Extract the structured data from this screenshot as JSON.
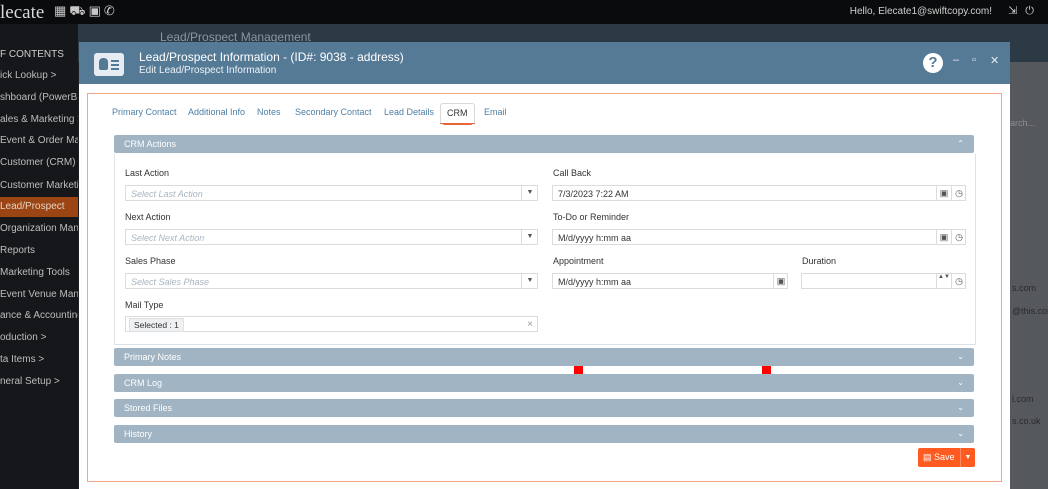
{
  "app": {
    "brand": "lecate",
    "top_icons": "▦⛟▣✆",
    "greeting": "Hello, Elecate1@swiftcopy.com!",
    "top_right_icons": "⇲⏻"
  },
  "sidebar": {
    "items": [
      {
        "label": "F CONTENTS"
      },
      {
        "label": "ick Lookup  >"
      },
      {
        "label": "shboard (PowerBI)"
      },
      {
        "label": "ales & Marketing  >"
      },
      {
        "label": "Event & Order Mana..."
      },
      {
        "label": "Customer (CRM)  ∨"
      },
      {
        "label": "   Customer Marketing"
      },
      {
        "label": "   Lead/Prospect"
      },
      {
        "label": "   Organization Mana..."
      },
      {
        "label": "   Reports"
      },
      {
        "label": "   Marketing Tools"
      },
      {
        "label": "Event Venue Manage"
      },
      {
        "label": "ance & Accounting"
      },
      {
        "label": "oduction  >"
      },
      {
        "label": "ta Items  >"
      },
      {
        "label": "neral Setup  >"
      }
    ]
  },
  "background": {
    "page_title": "Lead/Prospect Management",
    "search_placeholder": "arch...",
    "right_snippets": [
      "s.com",
      "@this.com",
      "l.com",
      "s.co.uk"
    ]
  },
  "modal": {
    "title": "Lead/Prospect Information - (ID#: 9038 - address)",
    "subtitle": "Edit Lead/Prospect Information",
    "help": "?",
    "minimize": "–",
    "maximize": "▫",
    "close": "✕",
    "tabs": [
      {
        "label": "Primary Contact"
      },
      {
        "label": "Additional Info"
      },
      {
        "label": "Notes"
      },
      {
        "label": "Secondary Contact"
      },
      {
        "label": "Lead Details"
      },
      {
        "label": "CRM",
        "active": true
      },
      {
        "label": "Email"
      }
    ],
    "panels": {
      "crm_actions": "CRM Actions",
      "primary_notes": "Primary Notes",
      "crm_log": "CRM Log",
      "stored_files": "Stored Files",
      "history": "History"
    },
    "chevrons": {
      "up": "⌃",
      "down": "⌄",
      "select": "▼",
      "spin": "▲▼"
    },
    "fields": {
      "last_action": {
        "label": "Last Action",
        "placeholder": "Select Last Action"
      },
      "next_action": {
        "label": "Next Action",
        "placeholder": "Select Next Action"
      },
      "sales_phase": {
        "label": "Sales Phase",
        "placeholder": "Select Sales Phase"
      },
      "mail_type": {
        "label": "Mail Type",
        "chip": "Selected : 1",
        "clear": "×"
      },
      "call_back": {
        "label": "Call Back",
        "value": "7/3/2023 7:22 AM"
      },
      "todo": {
        "label": "To-Do or Reminder",
        "value": "M/d/yyyy h:mm aa"
      },
      "appointment": {
        "label": "Appointment",
        "value": "M/d/yyyy h:mm aa"
      },
      "duration": {
        "label": "Duration",
        "value": ""
      }
    },
    "save_label": "Save",
    "icons": {
      "calendar": "▣",
      "clock": "◷",
      "save": "▤"
    }
  }
}
